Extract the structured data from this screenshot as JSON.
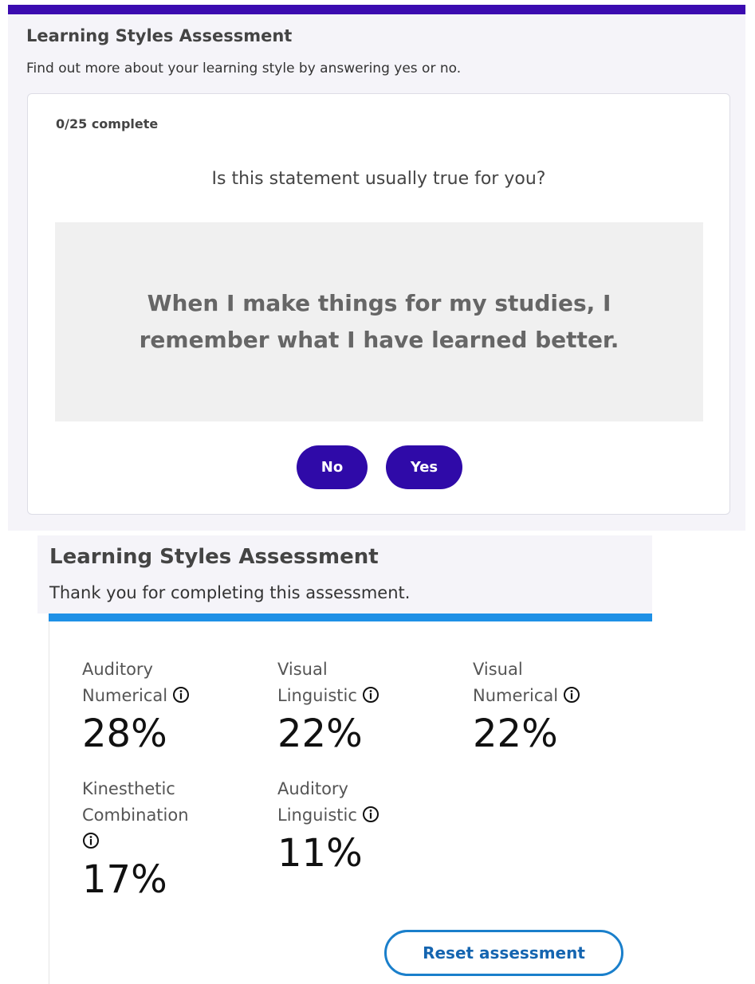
{
  "question_panel": {
    "title": "Learning Styles Assessment",
    "subtitle": "Find out more about your learning style by answering yes or no.",
    "progress": "0/25 complete",
    "prompt": "Is this statement usually true for you?",
    "statement": "When I make things for my studies, I remember what I have learned better.",
    "no_label": "No",
    "yes_label": "Yes"
  },
  "results_panel": {
    "title": "Learning Styles Assessment",
    "subtitle": "Thank you for completing this assessment.",
    "results": [
      {
        "line1": "Auditory",
        "line2": "Numerical",
        "value": "28%",
        "icon": "info-icon"
      },
      {
        "line1": "Visual",
        "line2": "Linguistic",
        "value": "22%",
        "icon": "info-icon"
      },
      {
        "line1": "Visual",
        "line2": "Numerical",
        "value": "22%",
        "icon": "info-icon"
      },
      {
        "line1": "Kinesthetic",
        "line2": "Combination",
        "value": "17%",
        "icon": "info-icon"
      },
      {
        "line1": "Auditory",
        "line2": "Linguistic",
        "value": "11%",
        "icon": "info-icon"
      }
    ],
    "reset_label": "Reset assessment"
  },
  "colors": {
    "accent_purple": "#2f0aa8",
    "top_bar": "#3b0bb0",
    "blue_bar": "#1e90e6",
    "reset_border": "#1a7fcb"
  }
}
